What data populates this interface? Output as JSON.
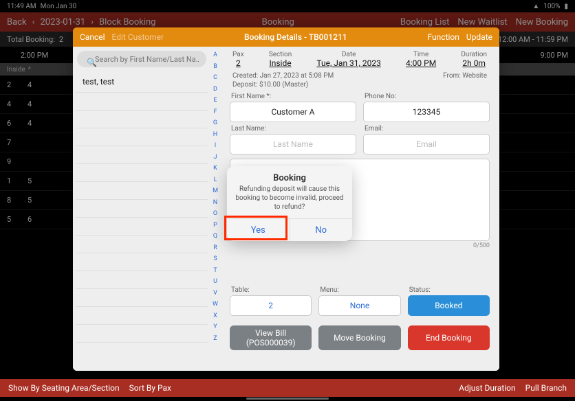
{
  "statusbar": {
    "time": "11:49 AM",
    "date": "Mon Jan 30",
    "battery": "100%"
  },
  "topnav": {
    "back": "Back",
    "date": "2023-01-31",
    "block": "Block Booking",
    "title": "Booking",
    "list": "Booking List",
    "waitlist": "New Waitlist",
    "newbooking": "New Booking"
  },
  "subhead": {
    "total_lbl": "Total Booking:",
    "total_val": "2",
    "range": "12:00 AM - 11:59 PM"
  },
  "timeheader": {
    "left": "2:00 PM",
    "right": "9:00 PM"
  },
  "insidebar": {
    "label": "Inside"
  },
  "schedule": {
    "rows": [
      {
        "a": "2",
        "b": "4"
      },
      {
        "a": "4",
        "b": "4"
      },
      {
        "a": "6",
        "b": "4"
      },
      {
        "a": "7",
        "b": ""
      },
      {
        "a": "9",
        "b": ""
      },
      {
        "a": "1",
        "b": "5"
      },
      {
        "a": "8",
        "b": "5"
      },
      {
        "a": "5",
        "b": "6"
      }
    ]
  },
  "bottombar": {
    "show": "Show By Seating Area/Section",
    "sort": "Sort By Pax",
    "adjust": "Adjust Duration",
    "pull": "Pull Branch"
  },
  "modal": {
    "header": {
      "cancel": "Cancel",
      "edit": "Edit Customer",
      "title": "Booking Details - TB001211",
      "function": "Function",
      "update": "Update"
    },
    "search": {
      "placeholder": "Search by First Name/Last Na…"
    },
    "result": "test, test",
    "alpha": [
      "A",
      "B",
      "C",
      "D",
      "E",
      "F",
      "G",
      "H",
      "I",
      "J",
      "K",
      "L",
      "M",
      "N",
      "O",
      "P",
      "Q",
      "R",
      "S",
      "T",
      "U",
      "V",
      "W",
      "X",
      "Y",
      "Z"
    ],
    "summary": {
      "pax_lbl": "Pax",
      "pax_val": "2",
      "section_lbl": "Section",
      "section_val": "Inside",
      "date_lbl": "Date",
      "date_val": "Tue, Jan 31, 2023",
      "time_lbl": "Time",
      "time_val": "4:00 PM",
      "dur_lbl": "Duration",
      "dur_val": "2h 0m"
    },
    "meta": {
      "created": "Created: Jan 27, 2023 at 5:08 PM",
      "from": "From: Website",
      "deposit": "Deposit: $10.00 (Master)"
    },
    "fields": {
      "fname_lbl": "First Name *:",
      "fname_val": "Customer A",
      "phone_lbl": "Phone No:",
      "phone_val": "123345",
      "lname_lbl": "Last Name:",
      "lname_ph": "Last Name",
      "email_lbl": "Email:",
      "email_ph": "Email",
      "counter": "0/500",
      "table_lbl": "Table:",
      "table_val": "2",
      "menu_lbl": "Menu:",
      "menu_val": "None",
      "status_lbl": "Status:",
      "status_val": "Booked"
    },
    "actions": {
      "viewbill_l1": "View Bill",
      "viewbill_l2": "(POS000039)",
      "move": "Move Booking",
      "end": "End Booking"
    }
  },
  "confirm": {
    "title": "Booking",
    "msg": "Refunding deposit will cause this booking to become invalid, proceed to refund?",
    "yes": "Yes",
    "no": "No"
  }
}
